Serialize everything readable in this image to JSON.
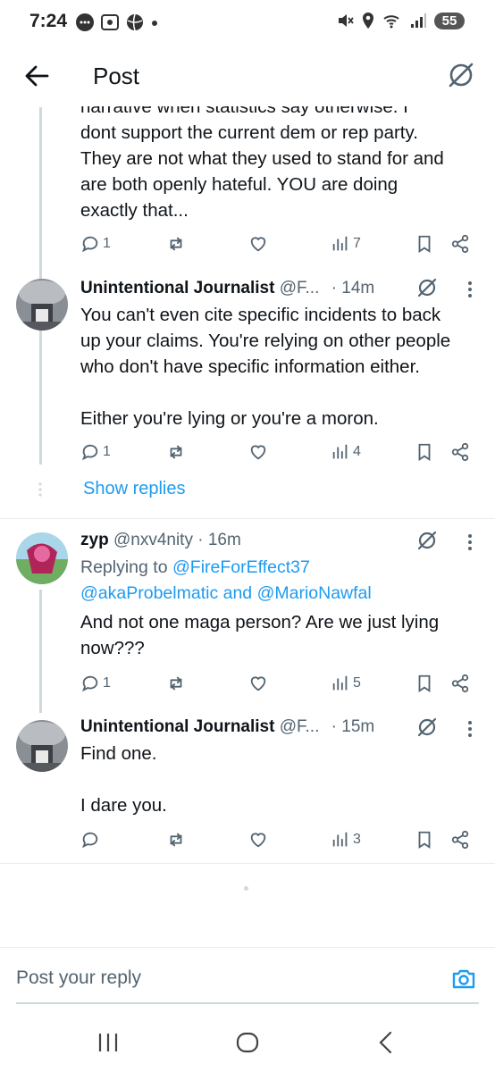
{
  "status_bar": {
    "time": "7:24",
    "battery": "55"
  },
  "header": {
    "title": "Post"
  },
  "colors": {
    "accent": "#1d9bf0",
    "text": "#0f1419",
    "muted": "#536471"
  },
  "tweets": [
    {
      "text": "narrative when statistics say otherwise. I\ndont support the current dem or rep party.\nThey are not what they used to stand for and\nare both openly hateful. YOU are doing\nexactly that...",
      "replies": "1",
      "views": "7"
    },
    {
      "name": "Unintentional Journalist",
      "handle": "@F...",
      "time": "· 14m",
      "text": "You can't even cite specific incidents to back\nup your claims. You're relying on other people\nwho don't have specific information either.\n\nEither you're lying or you're a moron.",
      "replies": "1",
      "views": "4"
    },
    {
      "name": "zyp",
      "handle": "@nxv4nity",
      "time": "· 16m",
      "reply_prefix": "Replying to ",
      "mentions": [
        "@FireForEffect37",
        "@akaProbelmatic",
        "@MarioNawfal"
      ],
      "mention_joiner": " and ",
      "text": "And not one maga person? Are we just lying\nnow???",
      "replies": "1",
      "views": "5"
    },
    {
      "name": "Unintentional Journalist",
      "handle": "@F...",
      "time": "· 15m",
      "text": "Find one.\n\nI dare you.",
      "replies": "",
      "views": "3"
    }
  ],
  "show_replies": "Show replies",
  "reply_bar": {
    "placeholder": "Post your reply"
  }
}
